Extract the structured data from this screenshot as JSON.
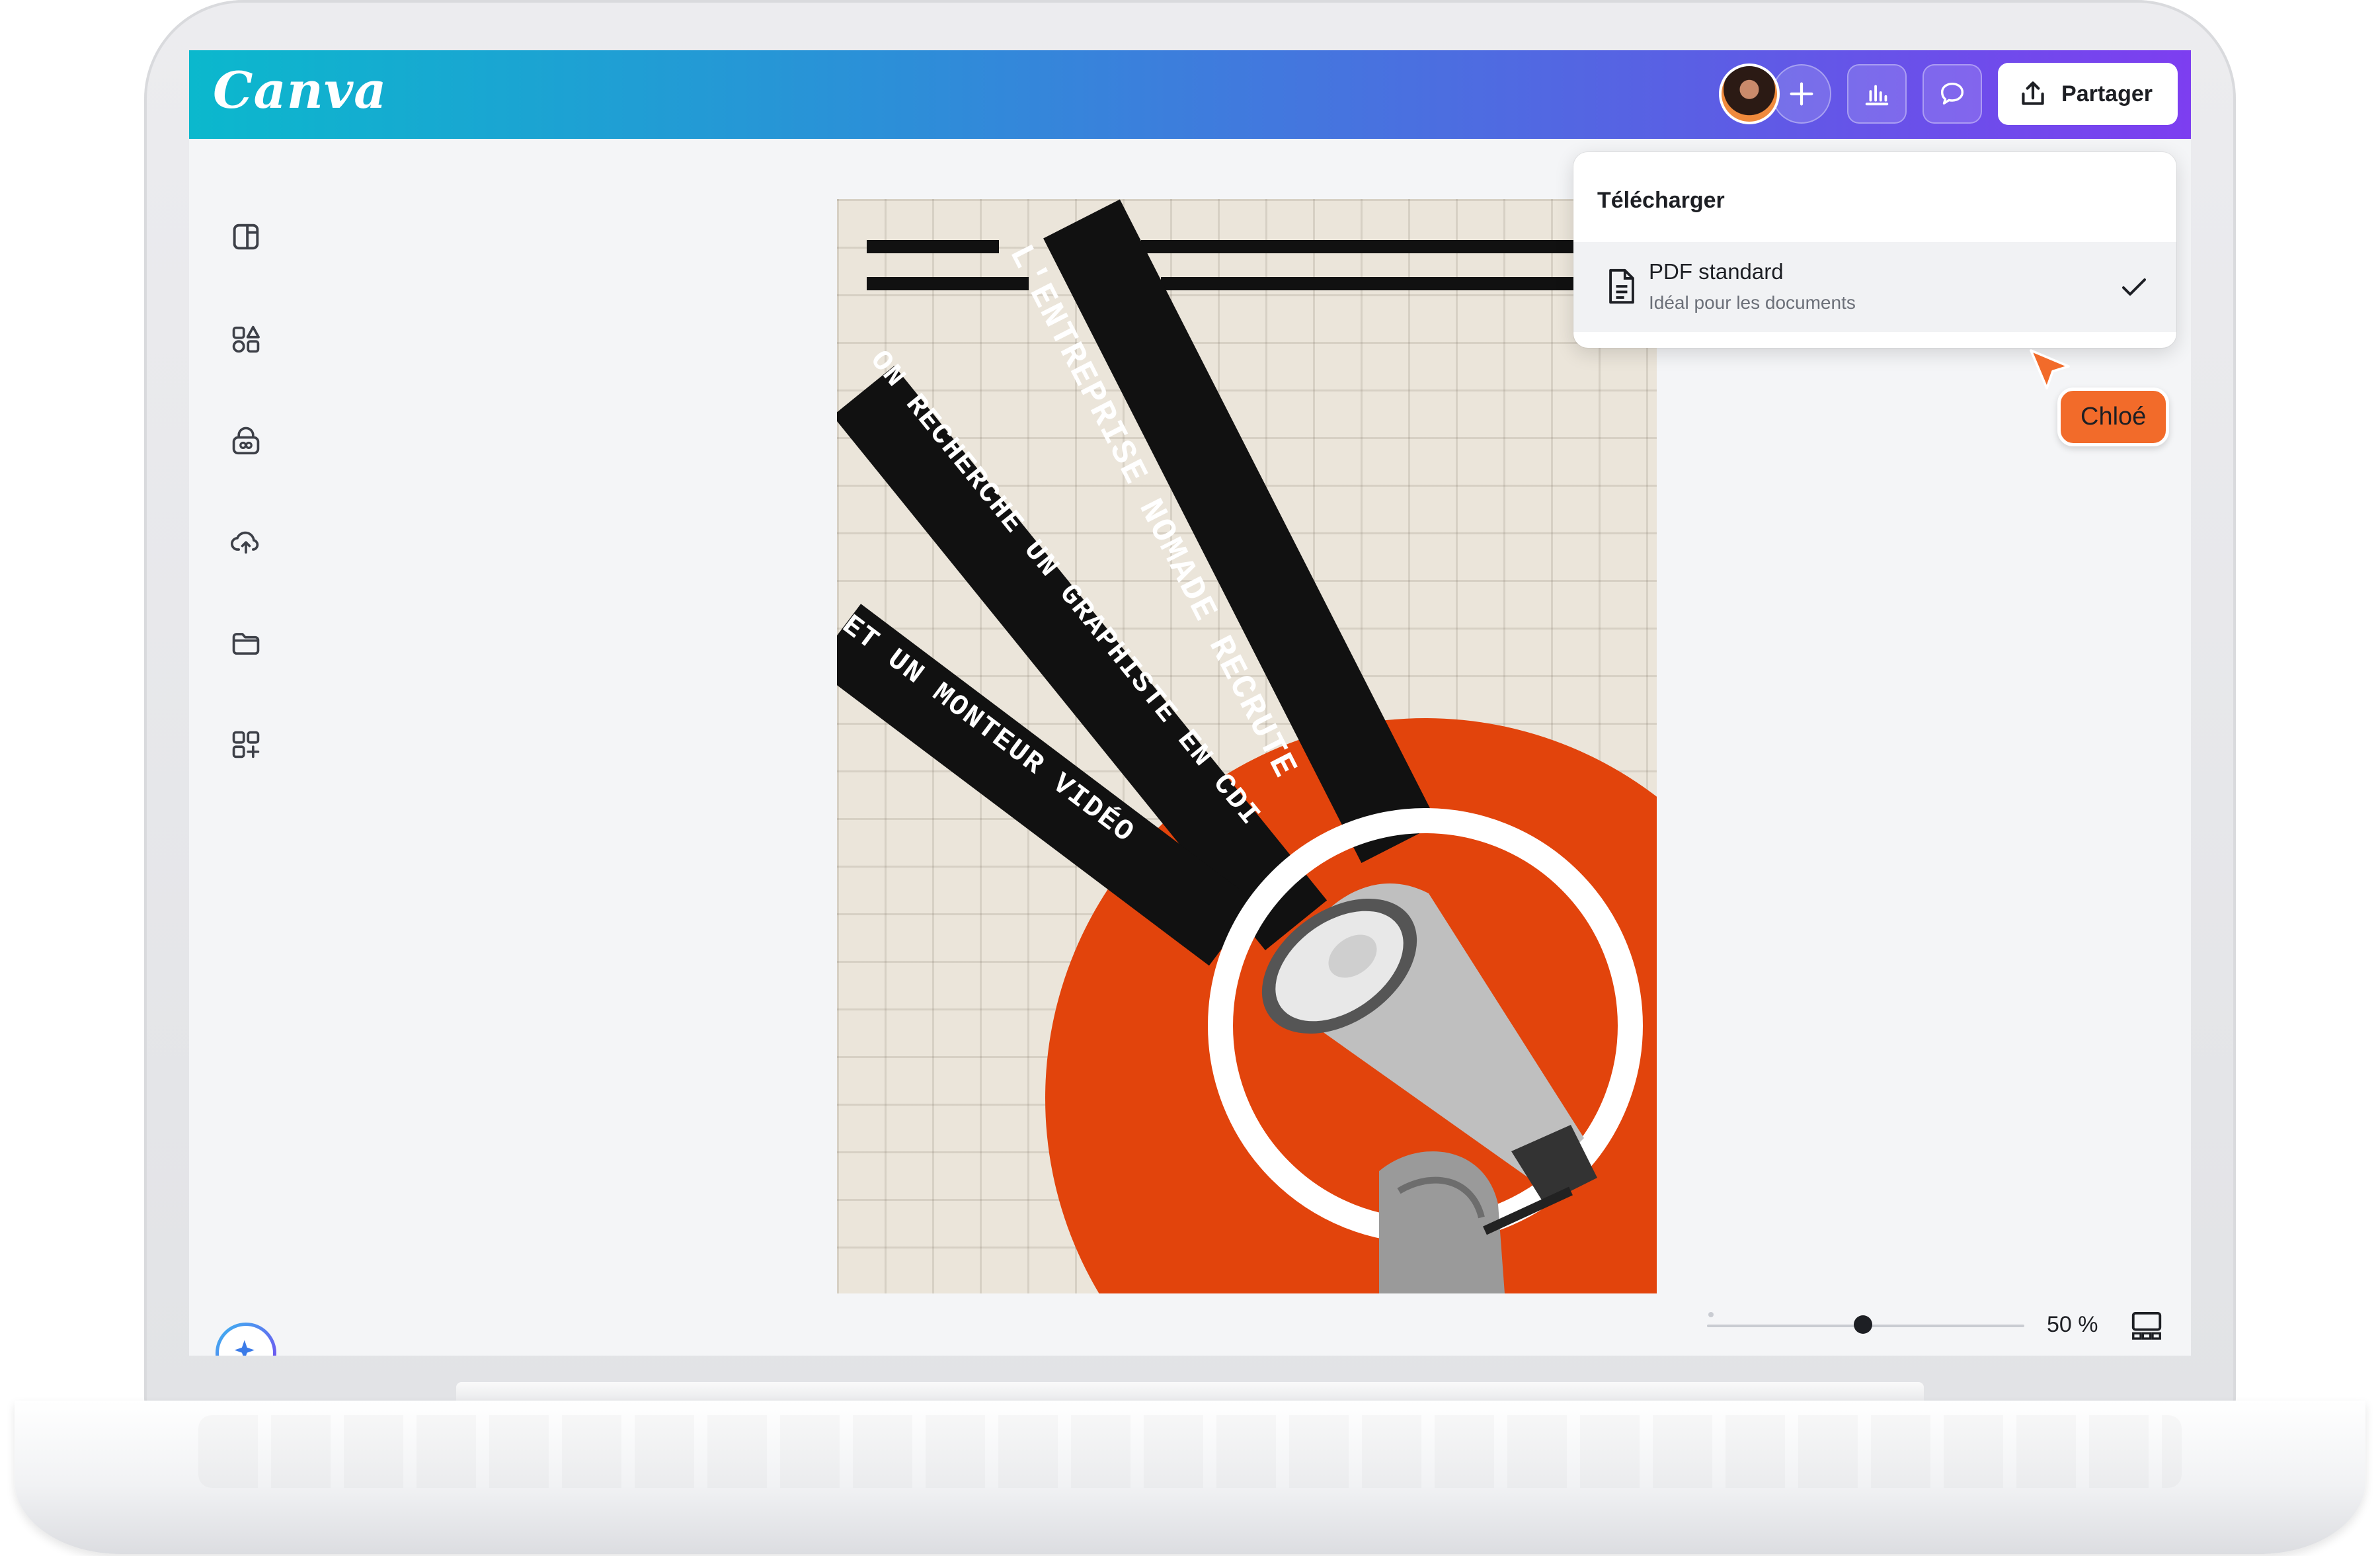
{
  "app": {
    "logo": "Canva"
  },
  "header": {
    "share_label": "Partager",
    "icons": [
      "avatar",
      "add-icon",
      "analytics-icon",
      "comment-icon",
      "share-icon"
    ]
  },
  "sidebar": {
    "items": [
      {
        "icon": "design-icon"
      },
      {
        "icon": "elements-icon"
      },
      {
        "icon": "brand-icon"
      },
      {
        "icon": "uploads-icon"
      },
      {
        "icon": "projects-icon"
      },
      {
        "icon": "apps-icon"
      }
    ],
    "magic_icon": "sparkle-icon"
  },
  "poster": {
    "line1": "L'ENTREPRISE NOMADE RECRUTE",
    "line2": "ON RECHERCHE UN GRAPHISTE EN CDI",
    "line3": "ET UN MONTEUR VIDÉO",
    "accent_color": "#e2440c",
    "paper_color": "#ebe5da"
  },
  "download_menu": {
    "title": "Télécharger",
    "item": {
      "title": "PDF standard",
      "subtitle": "Idéal pour les documents",
      "selected": true
    }
  },
  "collaborator": {
    "name": "Chloé",
    "color": "#f26b2a"
  },
  "zoom": {
    "value_label": "50 %",
    "value": 50
  }
}
